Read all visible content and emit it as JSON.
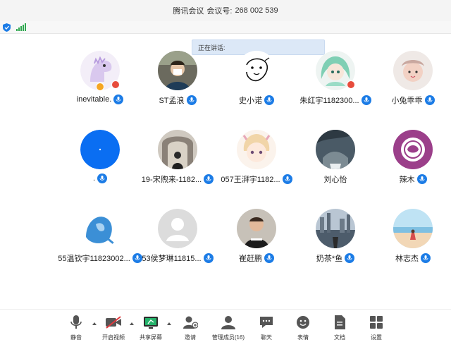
{
  "title": {
    "app_name": "腾讯会议",
    "meeting_label": "会议号:",
    "meeting_id": "268 002 539"
  },
  "speaking_banner": "正在讲话:",
  "colors": {
    "accent": "#1c7ce6",
    "signal": "#2fa84f",
    "banner_bg": "#dce8f7"
  },
  "participants": [
    {
      "name": "inevitable.",
      "avatar": "dinosaur"
    },
    {
      "name": "ST孟浪",
      "avatar": "photo-person"
    },
    {
      "name": "史小诺",
      "avatar": "sketch"
    },
    {
      "name": "朱红宇1182300...",
      "avatar": "anime-green"
    },
    {
      "name": "小兔乖乖",
      "avatar": "baby"
    },
    {
      "name": ".",
      "avatar": "blue-circle"
    },
    {
      "name": "19-宋煦来-1182...",
      "avatar": "photo-arch"
    },
    {
      "name": "057王湃宇1182...",
      "avatar": "anime-beige"
    },
    {
      "name": "刘心怡",
      "avatar": "photo-storm"
    },
    {
      "name": "辣木",
      "avatar": "purple-emblem"
    },
    {
      "name": "55温钦宇11823002...",
      "avatar": "blue-girl"
    },
    {
      "name": "53侯梦琳11815...",
      "avatar": "default-user"
    },
    {
      "name": "崔赶鹏",
      "avatar": "photo-kid"
    },
    {
      "name": "奶茶*鱼",
      "avatar": "photo-city"
    },
    {
      "name": "林志杰",
      "avatar": "photo-beach"
    }
  ],
  "toolbar": {
    "mute": "静音",
    "video": "开启视频",
    "share": "共享屏幕",
    "invite": "邀请",
    "members": "管理成员(16)",
    "chat": "聊天",
    "emoji": "表情",
    "docs": "文档",
    "settings": "设置"
  }
}
